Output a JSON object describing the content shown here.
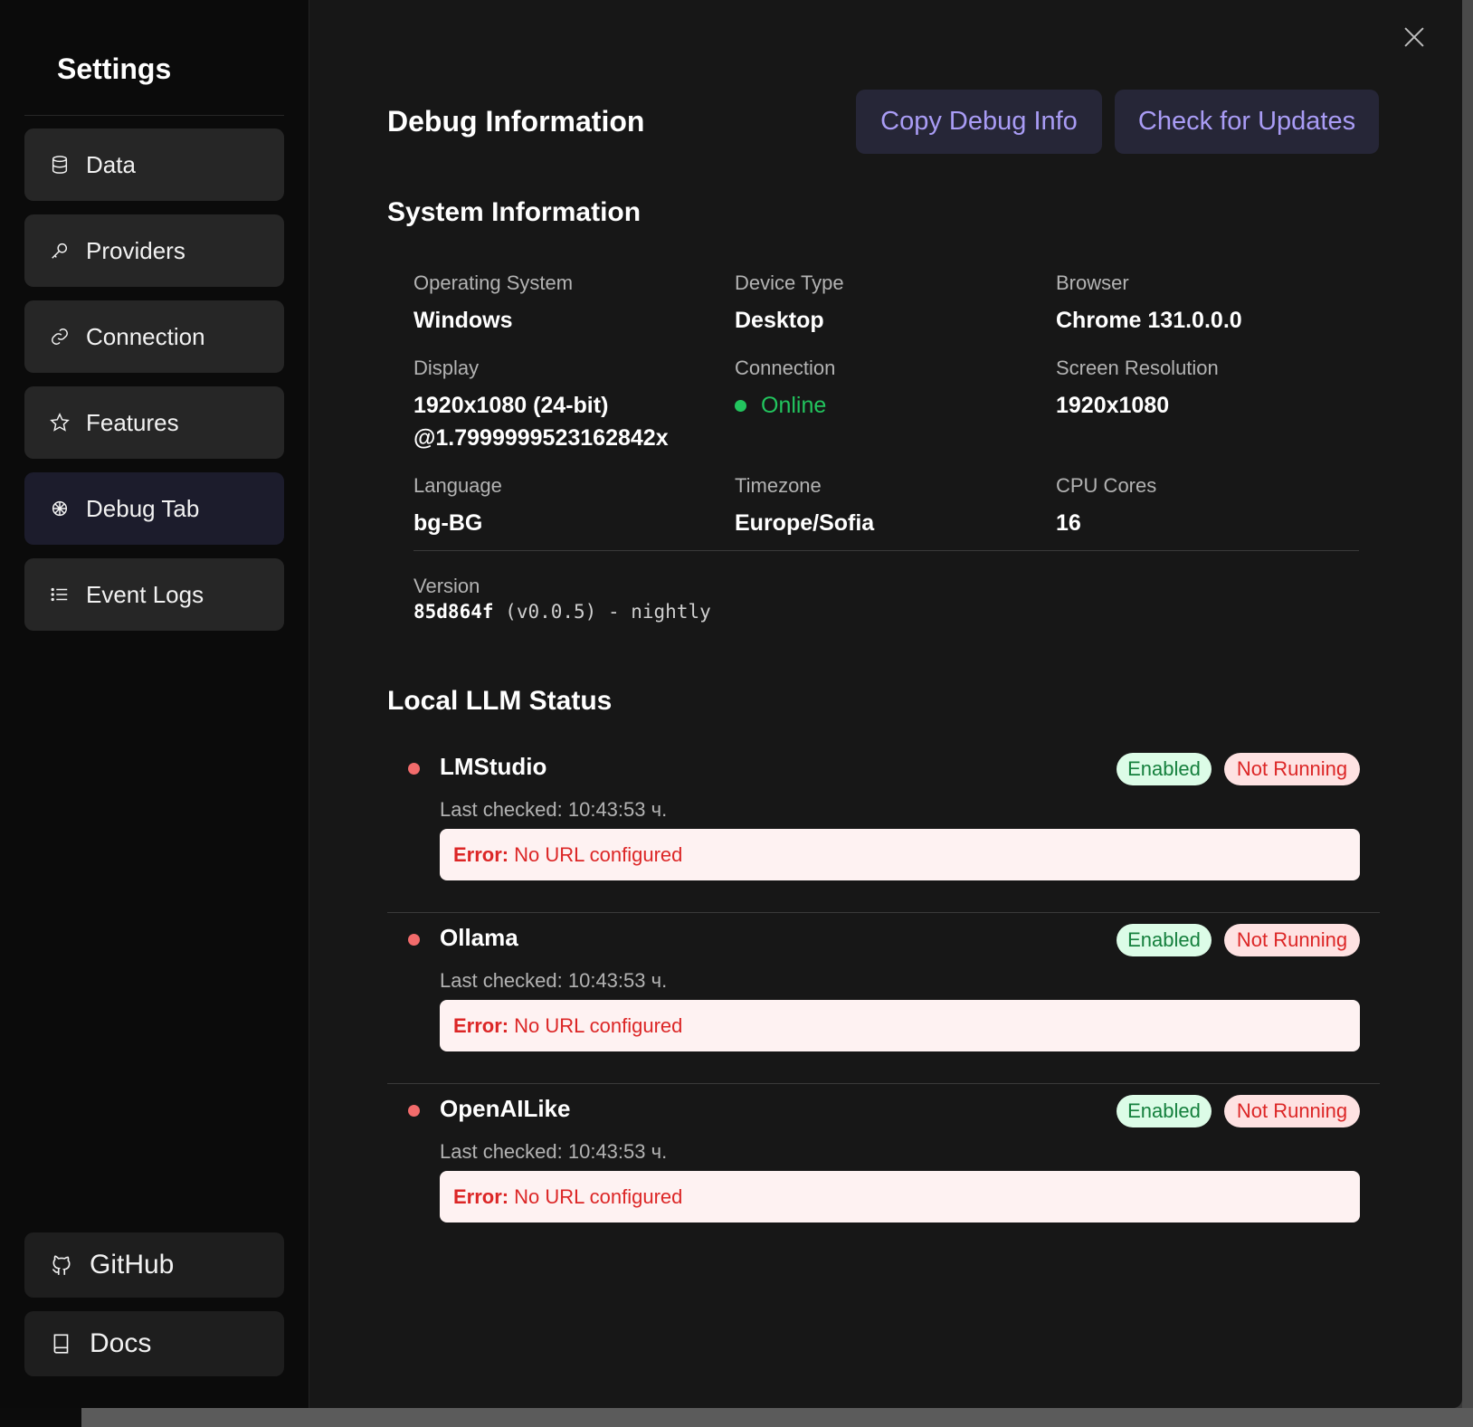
{
  "sidebar": {
    "title": "Settings",
    "items": [
      {
        "label": "Data",
        "icon": "database-icon"
      },
      {
        "label": "Providers",
        "icon": "key-icon"
      },
      {
        "label": "Connection",
        "icon": "link-icon"
      },
      {
        "label": "Features",
        "icon": "star-icon"
      },
      {
        "label": "Debug Tab",
        "icon": "bug-icon",
        "active": true
      },
      {
        "label": "Event Logs",
        "icon": "list-icon"
      }
    ],
    "bottom": [
      {
        "label": "GitHub",
        "icon": "github-icon"
      },
      {
        "label": "Docs",
        "icon": "book-icon"
      }
    ]
  },
  "header": {
    "title": "Debug Information",
    "copy_label": "Copy Debug Info",
    "update_label": "Check for Updates"
  },
  "system": {
    "title": "System Information",
    "os_label": "Operating System",
    "os_value": "Windows",
    "device_label": "Device Type",
    "device_value": "Desktop",
    "browser_label": "Browser",
    "browser_value": "Chrome 131.0.0.0",
    "display_label": "Display",
    "display_value_1": "1920x1080 (24-bit)",
    "display_value_2": "@1.7999999523162842x",
    "connection_label": "Connection",
    "connection_value": "Online",
    "resolution_label": "Screen Resolution",
    "resolution_value": "1920x1080",
    "language_label": "Language",
    "language_value": "bg-BG",
    "timezone_label": "Timezone",
    "timezone_value": "Europe/Sofia",
    "cpu_label": "CPU Cores",
    "cpu_value": "16",
    "version_label": "Version",
    "version_hash": "85d864f",
    "version_rest": "(v0.0.5) - nightly"
  },
  "llm": {
    "title": "Local LLM Status",
    "items": [
      {
        "name": "LMStudio",
        "enabled": "Enabled",
        "status": "Not Running",
        "checked": "Last checked: 10:43:53 ч.",
        "error_label": "Error:",
        "error": "No URL configured"
      },
      {
        "name": "Ollama",
        "enabled": "Enabled",
        "status": "Not Running",
        "checked": "Last checked: 10:43:53 ч.",
        "error_label": "Error:",
        "error": "No URL configured"
      },
      {
        "name": "OpenAILike",
        "enabled": "Enabled",
        "status": "Not Running",
        "checked": "Last checked: 10:43:53 ч.",
        "error_label": "Error:",
        "error": "No URL configured"
      }
    ]
  },
  "colors": {
    "accent": "#a99cf5",
    "online": "#22c55e",
    "error": "#dc2626"
  }
}
